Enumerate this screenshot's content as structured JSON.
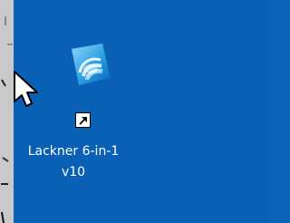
{
  "desktop": {
    "background_color": "#0a60b4",
    "icons": [
      {
        "icon": "lackner-app-icon",
        "shortcut_overlay": "shortcut-arrow-icon",
        "label": "Lackner 6-in-1\nv10"
      }
    ]
  },
  "cursor": {
    "icon": "mouse-pointer-icon"
  }
}
